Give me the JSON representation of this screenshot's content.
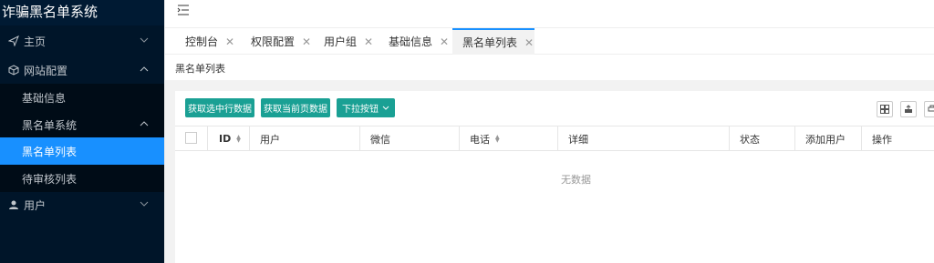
{
  "app": {
    "title": "诈骗黑名单系统"
  },
  "sidebar": {
    "items": [
      {
        "label": "主页",
        "icon": "send-icon"
      },
      {
        "label": "网站配置",
        "icon": "cube-icon"
      },
      {
        "label": "基础信息"
      },
      {
        "label": "黑名单系统"
      },
      {
        "label": "黑名单列表"
      },
      {
        "label": "待审核列表"
      },
      {
        "label": "用户",
        "icon": "user-icon"
      }
    ]
  },
  "tabs": [
    {
      "label": "控制台"
    },
    {
      "label": "权限配置"
    },
    {
      "label": "用户组"
    },
    {
      "label": "基础信息"
    },
    {
      "label": "黑名单列表"
    }
  ],
  "breadcrumb": "黑名单列表",
  "toolbar": {
    "btn_selected": "获取选中行数据",
    "btn_current": "获取当前页数据",
    "btn_dropdown": "下拉按钮"
  },
  "table": {
    "columns": [
      "ID",
      "用户",
      "微信",
      "电话",
      "详细",
      "状态",
      "添加用户",
      "操作"
    ],
    "empty_text": "无数据"
  },
  "colors": {
    "sidebar_bg": "#001529",
    "active": "#1890ff",
    "button": "#1aa094"
  }
}
